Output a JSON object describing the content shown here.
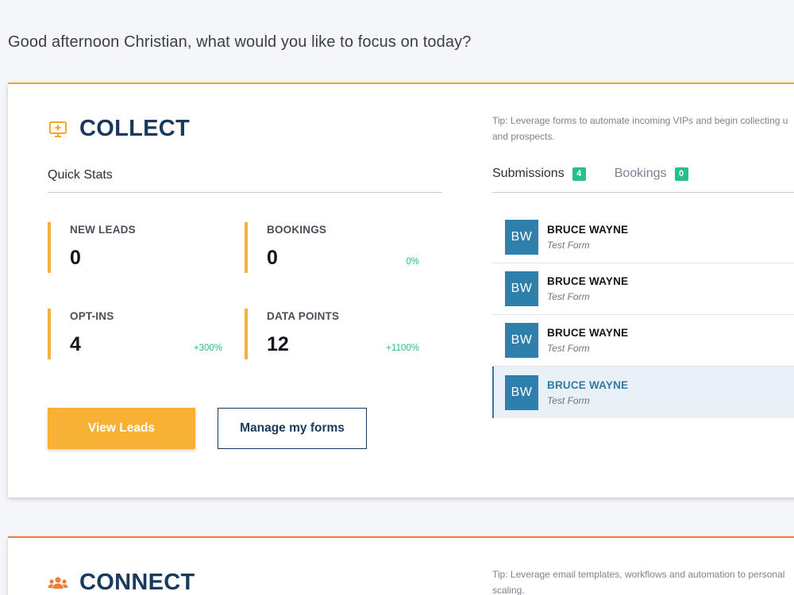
{
  "greeting": "Good afternoon Christian, what would you like to focus on today?",
  "collect": {
    "title": "COLLECT",
    "icon": "monitor-plus-icon",
    "tip": "Tip: Leverage forms to automate incoming VIPs and begin collecting u",
    "tip_line2": "and prospects.",
    "quick_stats_label": "Quick Stats",
    "stats": [
      {
        "label": "NEW LEADS",
        "value": "0",
        "change": ""
      },
      {
        "label": "BOOKINGS",
        "value": "0",
        "change": "0%"
      },
      {
        "label": "OPT-INS",
        "value": "4",
        "change": "+300%"
      },
      {
        "label": "DATA POINTS",
        "value": "12",
        "change": "+1100%"
      }
    ],
    "buttons": {
      "view_leads": "View Leads",
      "manage_forms": "Manage my forms"
    },
    "tabs": [
      {
        "label": "Submissions",
        "count": "4"
      },
      {
        "label": "Bookings",
        "count": "0"
      }
    ],
    "submissions": [
      {
        "initials": "BW",
        "name": "BRUCE WAYNE",
        "form": "Test Form"
      },
      {
        "initials": "BW",
        "name": "BRUCE WAYNE",
        "form": "Test Form"
      },
      {
        "initials": "BW",
        "name": "BRUCE WAYNE",
        "form": "Test Form"
      },
      {
        "initials": "BW",
        "name": "BRUCE WAYNE",
        "form": "Test Form"
      }
    ]
  },
  "connect": {
    "title": "CONNECT",
    "icon": "people-icon",
    "tip": "Tip: Leverage email templates, workflows and automation to personal",
    "tip_line2": "scaling."
  },
  "colors": {
    "accent": "#f5a623",
    "navy": "#173a5e",
    "success": "#27c08a",
    "avatar": "#2f7fad",
    "connect_accent": "#f07d3a"
  }
}
